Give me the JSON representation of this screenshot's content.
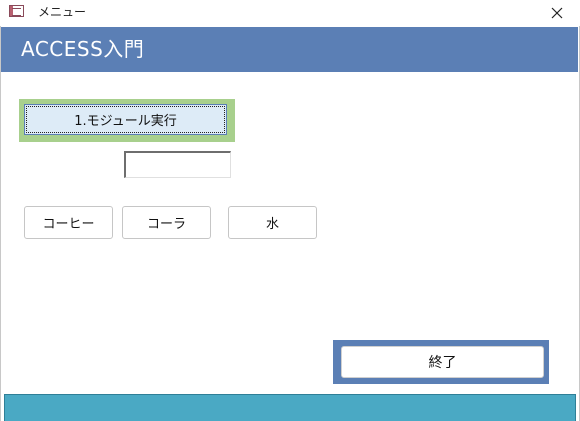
{
  "window": {
    "title": "メニュー",
    "app_icon": "form-icon",
    "close_icon": "close-icon"
  },
  "header": {
    "title": "ACCESS入門"
  },
  "main": {
    "run_module_label": "1.モジュール実行",
    "text_value": "",
    "choices": [
      {
        "label": "コーヒー"
      },
      {
        "label": "コーラ"
      },
      {
        "label": "水"
      }
    ],
    "end_label": "終了"
  },
  "colors": {
    "header_bg": "#5b7fb5",
    "run_frame": "#a8d08d",
    "run_button_bg": "#ddebf7",
    "end_frame": "#5b7fb5",
    "footer_bg": "#4aa9c4"
  }
}
